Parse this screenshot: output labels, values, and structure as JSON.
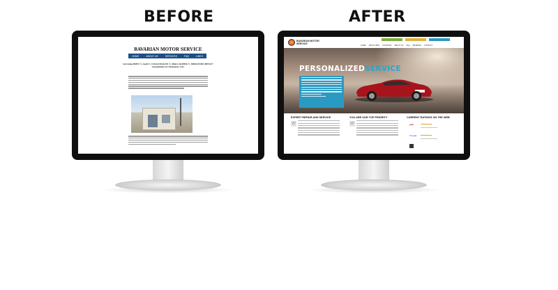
{
  "labels": {
    "before": "BEFORE",
    "after": "AFTER"
  },
  "before_site": {
    "title": "BAVARIAN MOTOR SERVICE",
    "nav": [
      "HOME",
      "ABOUT US",
      "SERVICES",
      "FAQ",
      "LINKS"
    ],
    "subheading": "Servicing BMW ®, Audi ®, VOLKSWAGEN ®, Mini COOPER ®, MERCEDES BENZ® Automobiles in Clackamas, Ore."
  },
  "after_site": {
    "logo_text": "BAVARIAN MOTOR SERVICE",
    "menu": [
      "HOME",
      "ABOUT BMS",
      "COUPONS",
      "ABOUT US",
      "FAQ",
      "RESERVE",
      "CONTACT"
    ],
    "hero_title_main": "PERSONALIZED",
    "hero_title_accent": "SERVICE",
    "sections": [
      "EXPERT REPAIR AND SERVICE",
      "YOU ARE OUR TOP PRIORITY",
      "CURRENT RATINGS ON THE WEB"
    ],
    "ratings": [
      "yelp",
      "Google"
    ]
  },
  "colors": {
    "before_nav": "#1d4f86",
    "after_accent": "#2aa6c9",
    "bezel": "#0f0f10"
  }
}
